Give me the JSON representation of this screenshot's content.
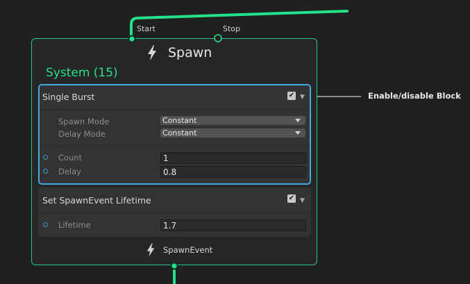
{
  "node": {
    "start_label": "Start",
    "stop_label": "Stop",
    "title": "Spawn",
    "system_label": "System (15)",
    "footer_label": "SpawnEvent"
  },
  "blocks": [
    {
      "title": "Single Burst",
      "enabled": true,
      "settings": [
        {
          "label": "Spawn Mode",
          "value": "Constant"
        },
        {
          "label": "Delay Mode",
          "value": "Constant"
        }
      ],
      "properties": [
        {
          "label": "Count",
          "value": "1"
        },
        {
          "label": "Delay",
          "value": "0.8"
        }
      ]
    },
    {
      "title": "Set SpawnEvent Lifetime",
      "enabled": true,
      "properties": [
        {
          "label": "Lifetime",
          "value": "1.7"
        }
      ]
    }
  ],
  "callout": {
    "text": "Enable/disable Block"
  },
  "colors": {
    "accent": "#24e28a",
    "selection": "#45a9e6",
    "port": "#3aa3c4"
  },
  "icons": {
    "checkbox": "check-icon",
    "chevron": "chevron-down-icon",
    "bolt": "lightning-icon"
  }
}
